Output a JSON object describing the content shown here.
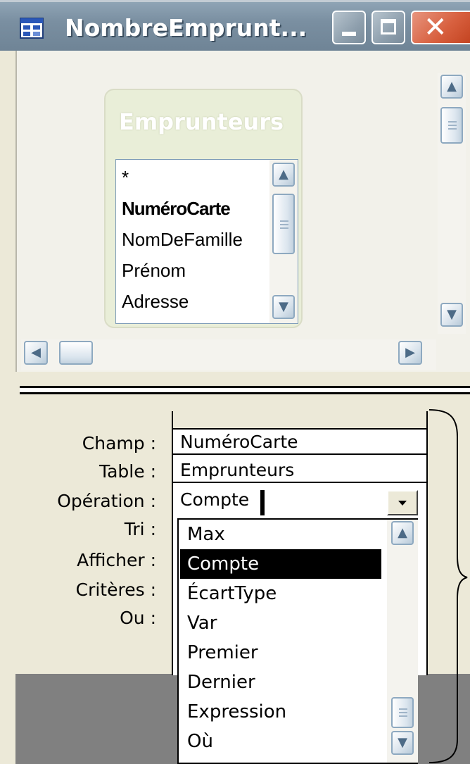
{
  "window": {
    "title": "NombreEmprunt...",
    "controls": [
      "minimize",
      "maximize",
      "close"
    ]
  },
  "table_pane": {
    "table_name": "Emprunteurs",
    "fields": [
      "*",
      "NuméroCarte",
      "NomDeFamille",
      "Prénom",
      "Adresse"
    ],
    "primary_key": "NuméroCarte"
  },
  "grid": {
    "row_labels": {
      "field": "Champ :",
      "table": "Table :",
      "operation": "Opération :",
      "sort": "Tri :",
      "show": "Afficher :",
      "criteria": "Critères :",
      "or": "Ou :"
    },
    "column": {
      "field": "NuméroCarte",
      "table": "Emprunteurs",
      "operation": "Compte"
    }
  },
  "operation_dropdown": {
    "options": [
      "Max",
      "Compte",
      "ÉcartType",
      "Var",
      "Premier",
      "Dernier",
      "Expression",
      "Où"
    ],
    "selected": "Compte"
  },
  "colors": {
    "titlebar": "#7a8fa1",
    "close_button": "#d8603f",
    "selection": "#000000"
  }
}
